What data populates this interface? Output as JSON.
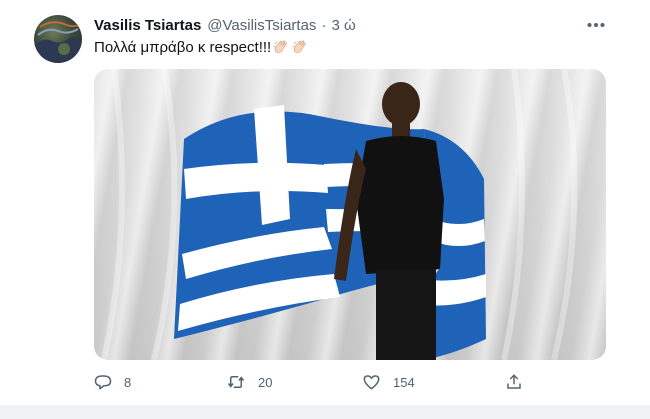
{
  "tweet": {
    "display_name": "Vasilis Tsiartas",
    "handle": "@VasilisTsiartas",
    "separator": "·",
    "time": "3 ώ",
    "text": "Πολλά μπράβο κ respect!!!",
    "emoji": [
      "clapping-hands",
      "clapping-hands"
    ]
  },
  "actions": {
    "reply_count": "8",
    "retweet_count": "20",
    "like_count": "154"
  },
  "colors": {
    "text_primary": "#0f1419",
    "text_secondary": "#536471",
    "flag_blue": "#1f63b8"
  }
}
